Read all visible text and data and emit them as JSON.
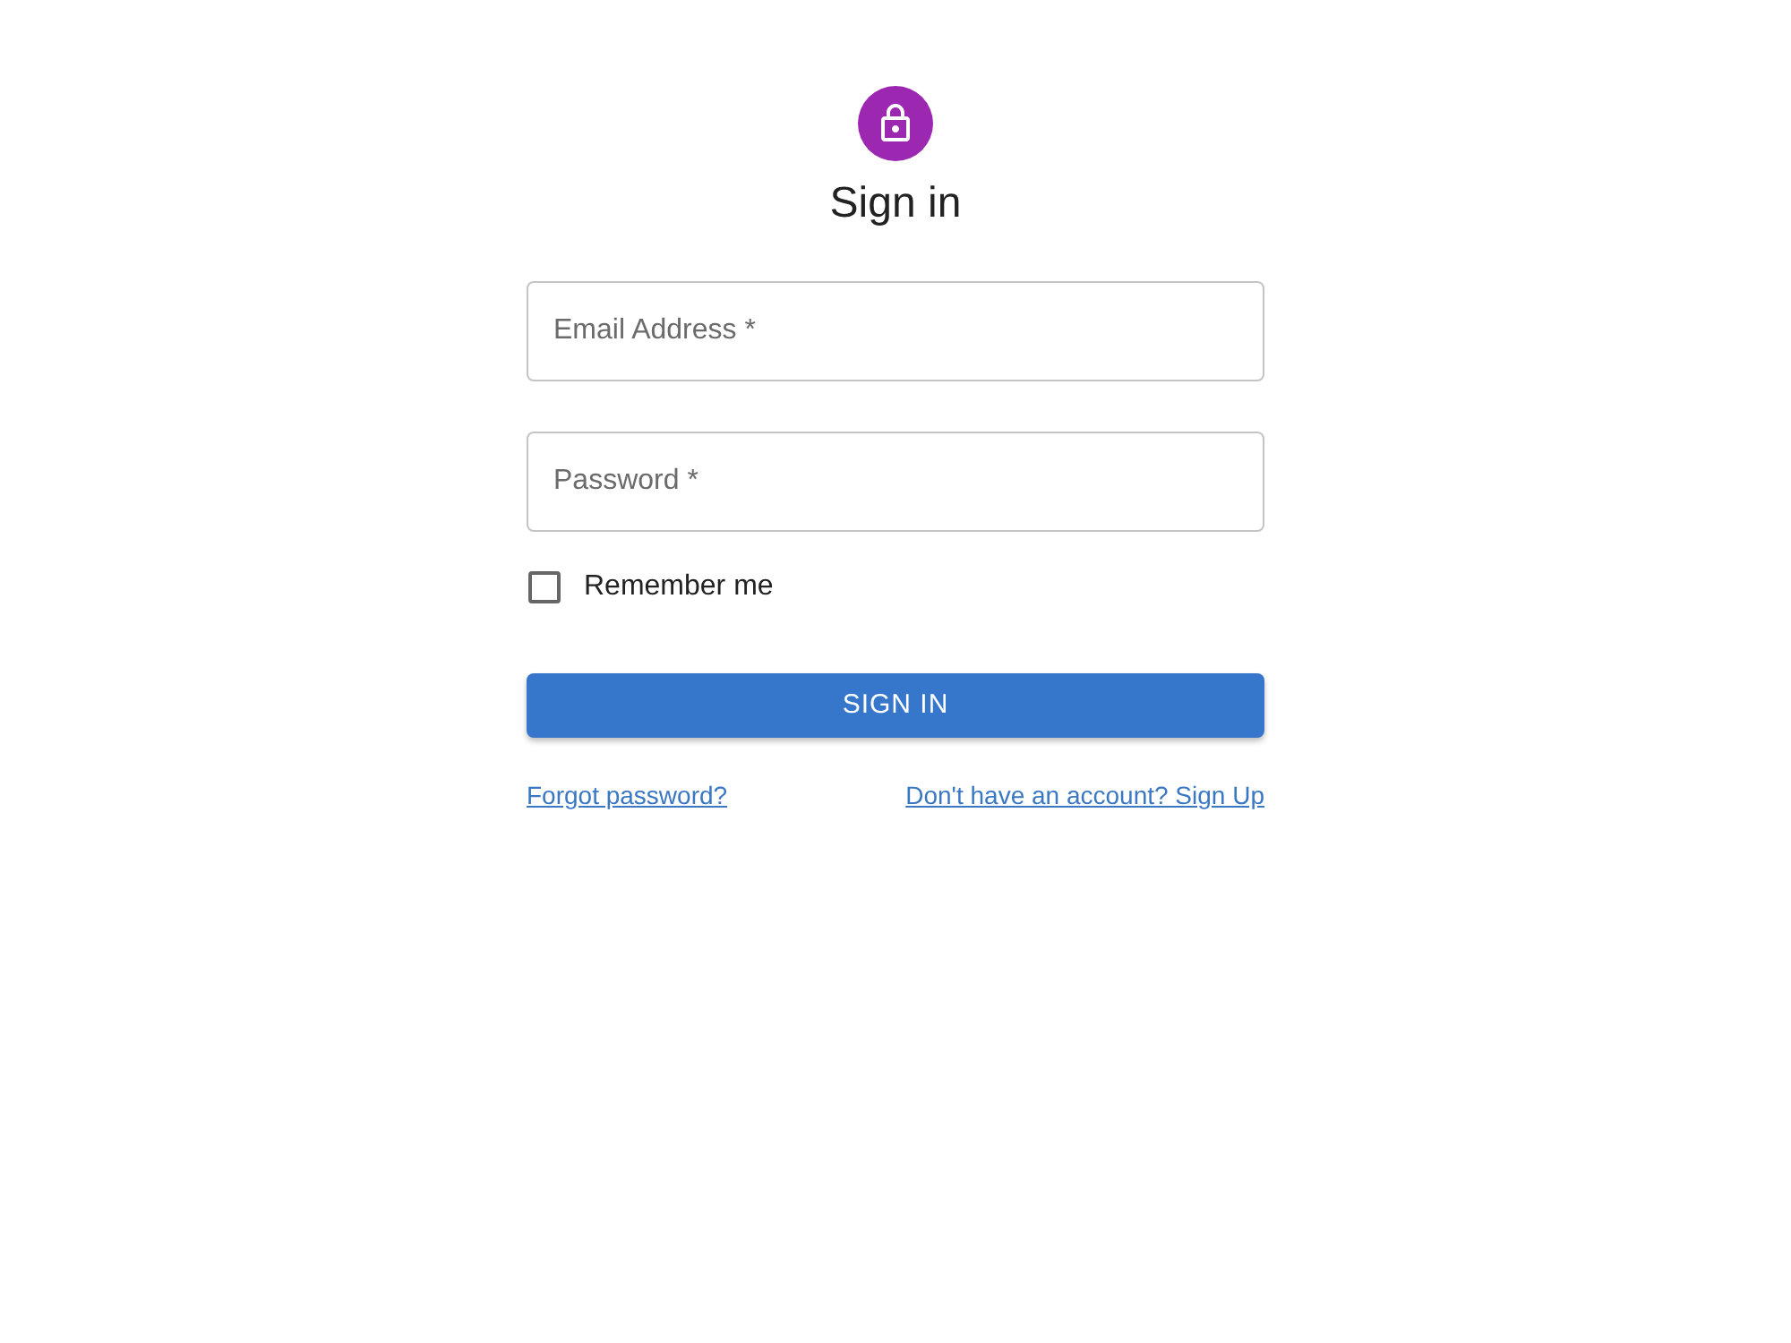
{
  "title": "Sign in",
  "fields": [
    {
      "placeholder": "Email Address *"
    },
    {
      "placeholder": "Password *"
    }
  ],
  "remember": {
    "label": "Remember me",
    "checked": false
  },
  "submit": {
    "label": "SIGN IN"
  },
  "links": [
    {
      "label": "Forgot password?"
    },
    {
      "label": "Don't have an account? Sign Up"
    }
  ]
}
